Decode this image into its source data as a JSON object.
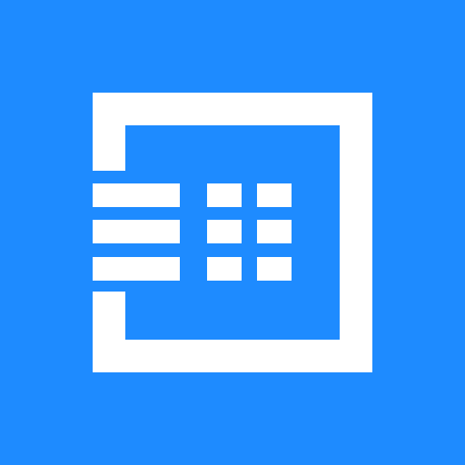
{
  "icon": {
    "name": "phone-keypad-app-icon",
    "background_color": "#1E8BFF",
    "foreground_color": "#FFFFFF",
    "keypad": {
      "rows": 3,
      "columns": 2
    },
    "lines": 3
  }
}
